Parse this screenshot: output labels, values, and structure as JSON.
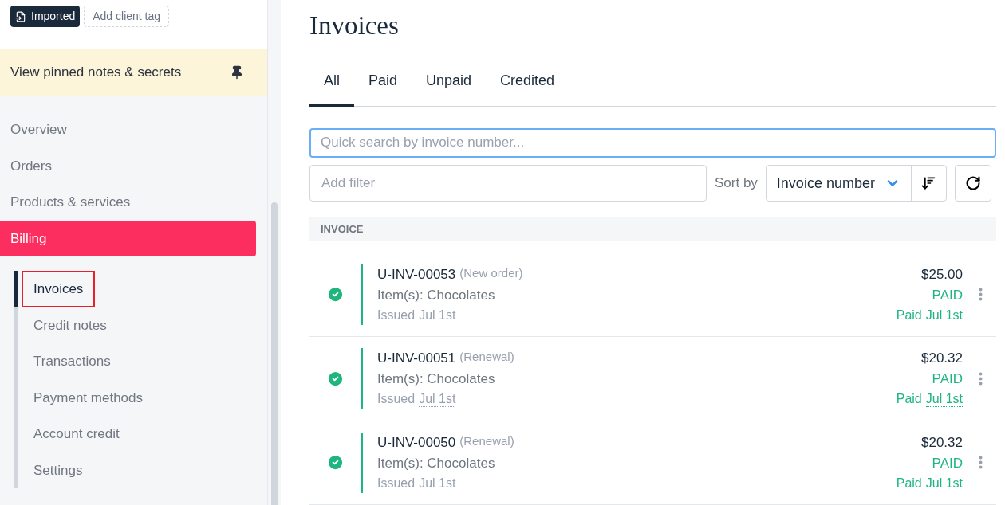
{
  "client_tags": [
    {
      "label": "Imported",
      "kind": "filled"
    },
    {
      "label": "Add client tag",
      "kind": "add"
    }
  ],
  "pinned_notes": {
    "label": "View pinned notes & secrets"
  },
  "sidebar": {
    "items": [
      {
        "label": "Overview",
        "selected": false
      },
      {
        "label": "Orders",
        "selected": false
      },
      {
        "label": "Products & services",
        "selected": false
      },
      {
        "label": "Billing",
        "selected": true,
        "children": [
          {
            "label": "Invoices",
            "selected": true,
            "highlighted": true
          },
          {
            "label": "Credit notes",
            "selected": false,
            "highlighted": false
          },
          {
            "label": "Transactions",
            "selected": false,
            "highlighted": false
          },
          {
            "label": "Payment methods",
            "selected": false,
            "highlighted": false
          },
          {
            "label": "Account credit",
            "selected": false,
            "highlighted": false
          },
          {
            "label": "Settings",
            "selected": false,
            "highlighted": false
          }
        ]
      }
    ]
  },
  "page_title": "Invoices",
  "tabs": [
    {
      "label": "All",
      "selected": true
    },
    {
      "label": "Paid",
      "selected": false
    },
    {
      "label": "Unpaid",
      "selected": false
    },
    {
      "label": "Credited",
      "selected": false
    }
  ],
  "search": {
    "placeholder": "Quick search by invoice number..."
  },
  "filter": {
    "placeholder": "Add filter"
  },
  "sort": {
    "label": "Sort by",
    "value": "Invoice number"
  },
  "table": {
    "column": "INVOICE",
    "rows": [
      {
        "number": "U-INV-00053",
        "type": "(New order)",
        "items": "Item(s): Chocolates",
        "issued_label": "Issued",
        "issued_date": "Jul 1st",
        "amount": "$25.00",
        "status": "PAID",
        "paid_label": "Paid",
        "paid_date": "Jul 1st",
        "color": "#1fb57f"
      },
      {
        "number": "U-INV-00051",
        "type": "(Renewal)",
        "items": "Item(s): Chocolates",
        "issued_label": "Issued",
        "issued_date": "Jul 1st",
        "amount": "$20.32",
        "status": "PAID",
        "paid_label": "Paid",
        "paid_date": "Jul 1st",
        "color": "#1fb57f"
      },
      {
        "number": "U-INV-00050",
        "type": "(Renewal)",
        "items": "Item(s): Chocolates",
        "issued_label": "Issued",
        "issued_date": "Jul 1st",
        "amount": "$20.32",
        "status": "PAID",
        "paid_label": "Paid",
        "paid_date": "Jul 1st",
        "color": "#1fb57f"
      }
    ]
  }
}
